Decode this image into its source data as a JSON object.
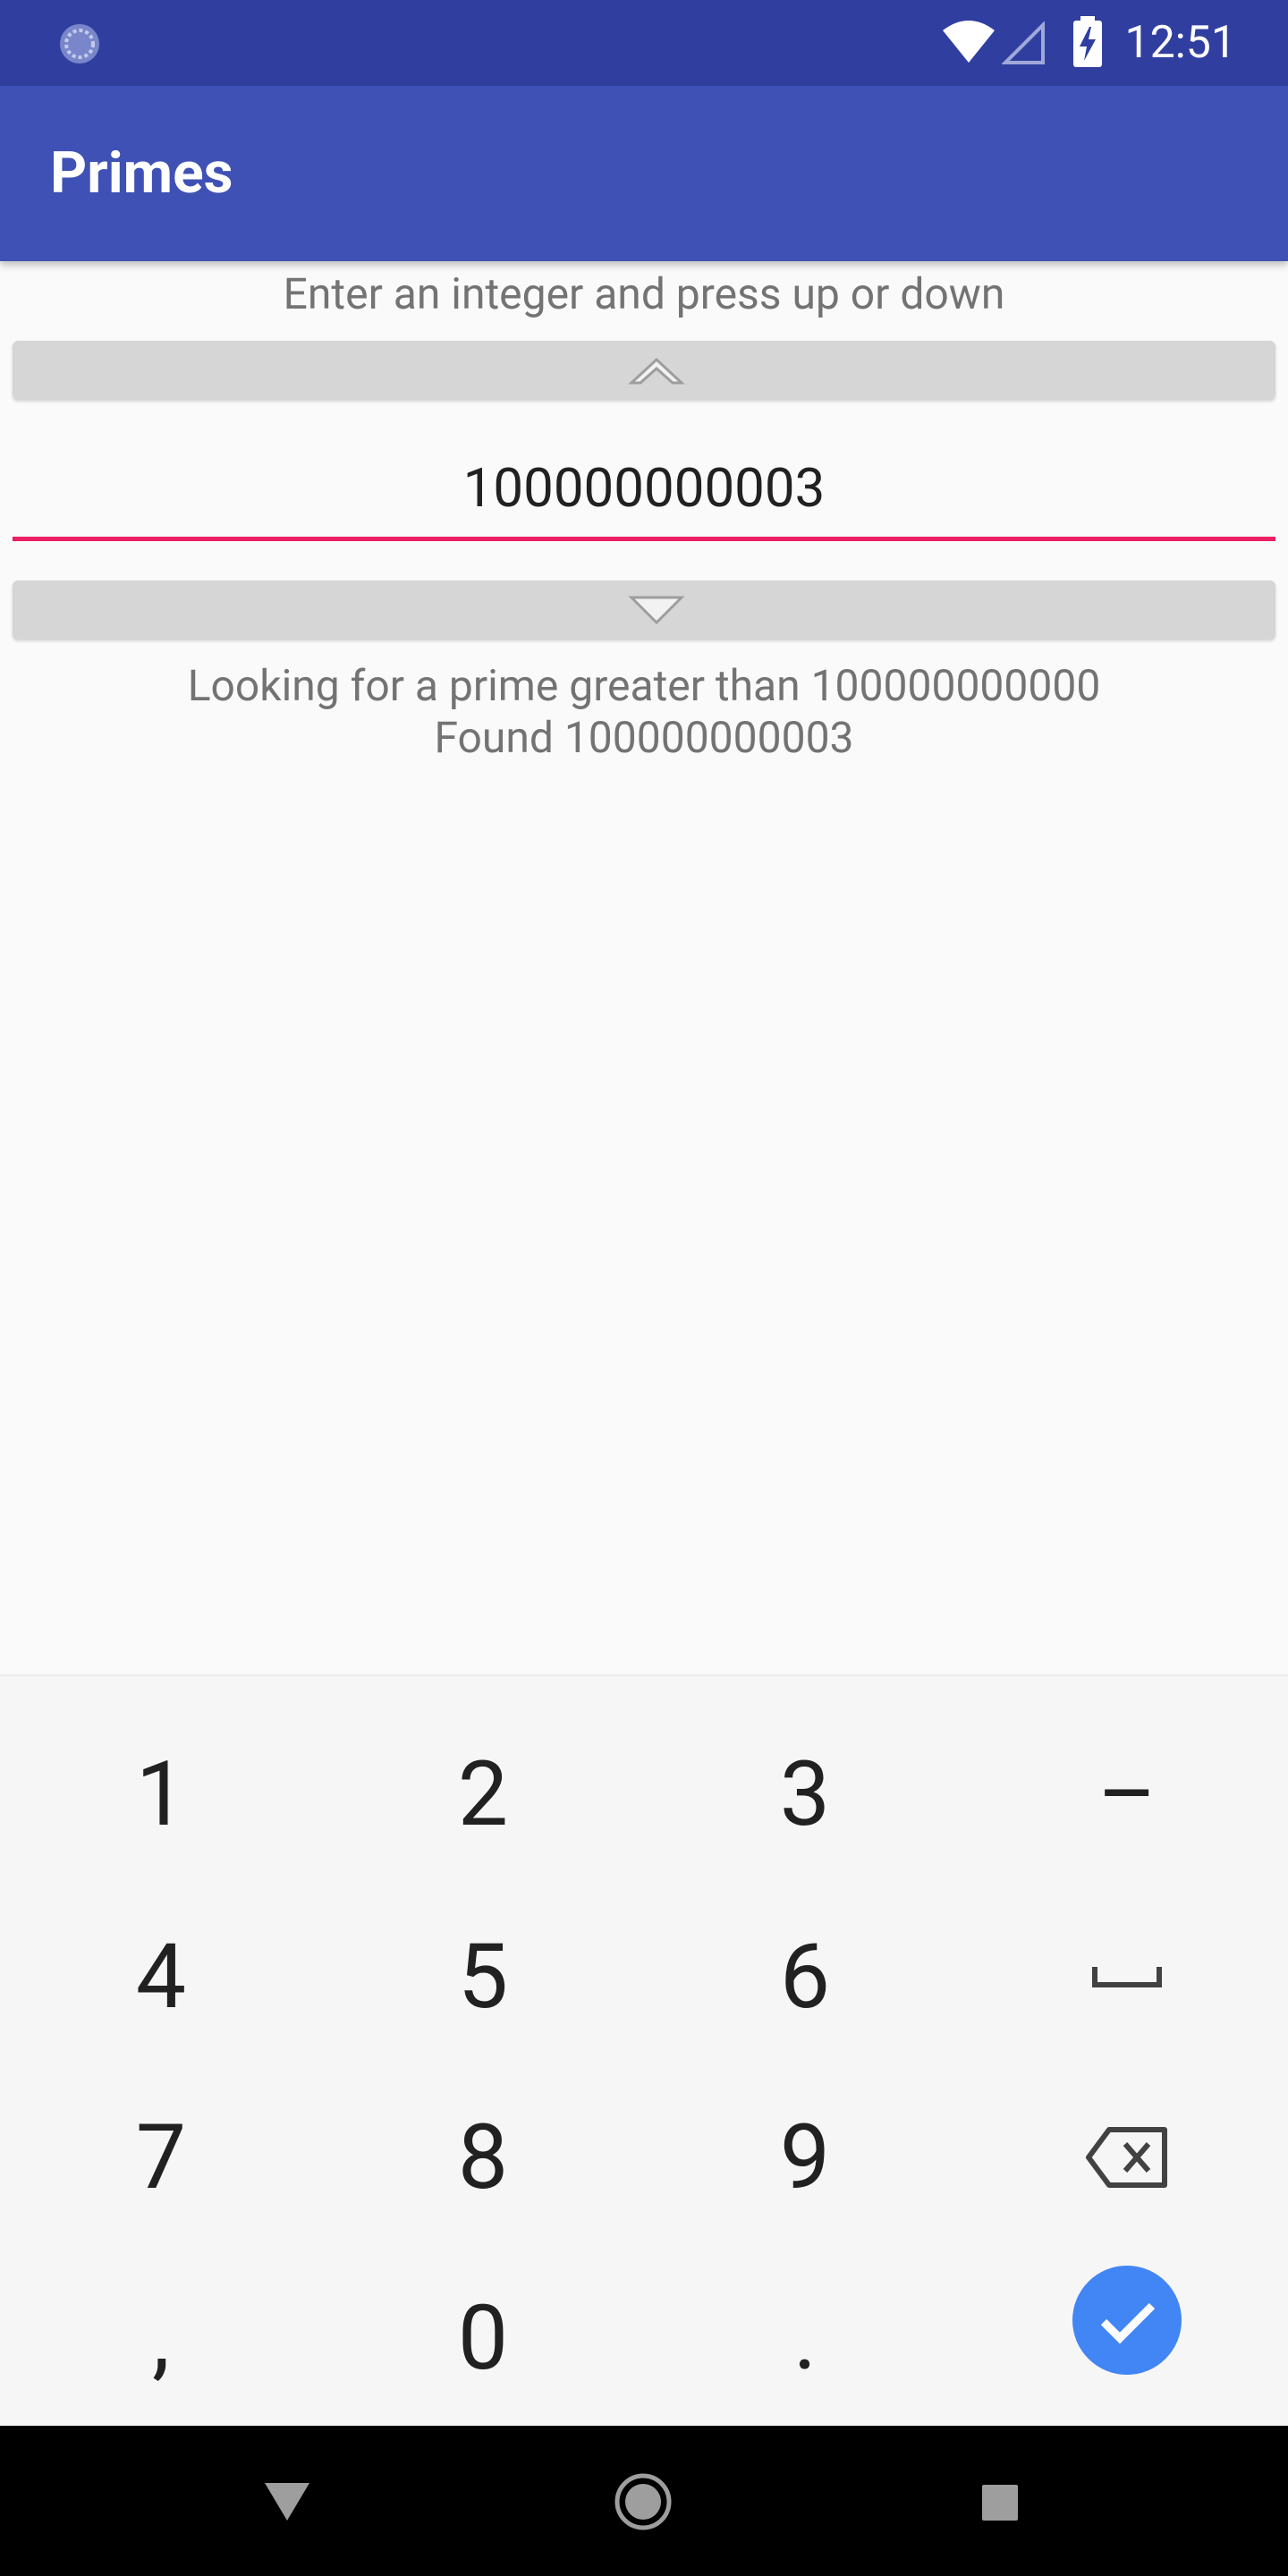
{
  "status_bar": {
    "time": "12:51",
    "icons": [
      "sync-icon",
      "wifi-icon",
      "cell-signal-icon",
      "battery-charging-icon"
    ]
  },
  "app_bar": {
    "title": "Primes"
  },
  "main": {
    "instruction": "Enter an integer and press up or down",
    "number_value": "100000000003",
    "result_line1": "Looking for a prime greater than 100000000000",
    "result_line2": "Found 100000000003"
  },
  "keyboard": {
    "keys": {
      "k1": "1",
      "k2": "2",
      "k3": "3",
      "minus": "–",
      "k4": "4",
      "k5": "5",
      "k6": "6",
      "k7": "7",
      "k8": "8",
      "k9": "9",
      "comma": ",",
      "k0": "0",
      "period": "."
    }
  },
  "colors": {
    "status_bar": "#303f9f",
    "app_bar": "#3f51b5",
    "accent": "#e91e63",
    "done_key": "#4285f4"
  }
}
